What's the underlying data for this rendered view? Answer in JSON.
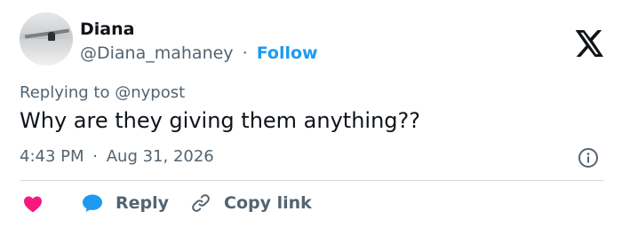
{
  "author": {
    "name": "Diana",
    "handle": "@Diana_mahaney",
    "separator": "·",
    "follow_label": "Follow"
  },
  "reply_context": {
    "prefix": "Replying to",
    "mention": "@nypost"
  },
  "tweet": {
    "text": "Why are they giving them anything??",
    "time": "4:43 PM",
    "separator": "·",
    "date": "Aug 31, 2026"
  },
  "actions": {
    "reply_label": "Reply",
    "copy_link_label": "Copy link"
  },
  "icons": {
    "brand": "x-logo-icon",
    "info": "info-icon",
    "like": "heart-icon",
    "reply": "speech-bubble-icon",
    "copy": "link-icon"
  },
  "colors": {
    "accent": "#1d9bf0",
    "like": "#f91880",
    "reply_bubble": "#1d9bf0",
    "secondary_text": "#536471",
    "primary_text": "#0f1419"
  }
}
